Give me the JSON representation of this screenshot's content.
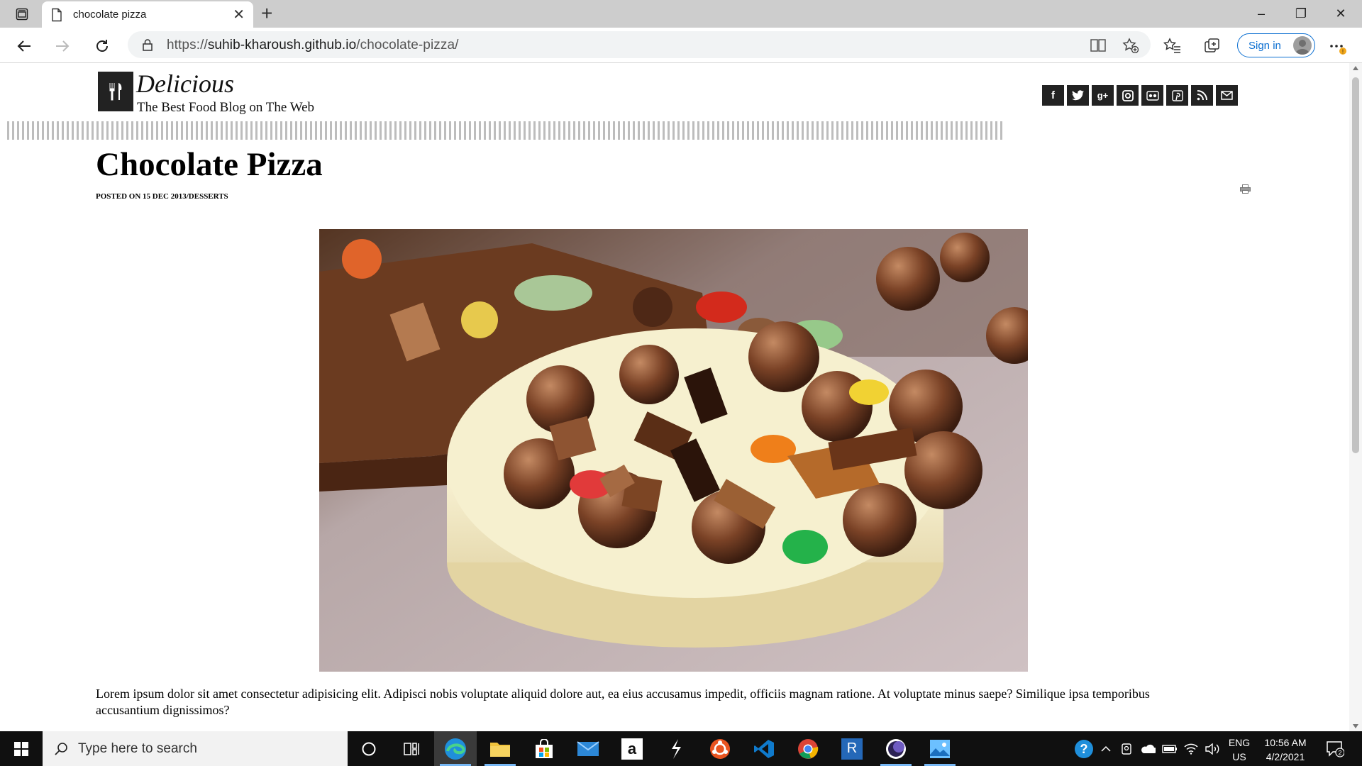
{
  "browser": {
    "tab": {
      "title": "chocolate pizza",
      "close": "✕"
    },
    "new_tab": "+",
    "url": {
      "scheme": "https://",
      "host": "suhib-kharoush.github.io",
      "path": "/chocolate-pizza/"
    },
    "sign_in": "Sign in",
    "window_controls": {
      "minimize": "–",
      "restore": "❐",
      "close": "✕"
    }
  },
  "site": {
    "name": "Delicious",
    "tagline": "The Best Food Blog on The Web",
    "social": [
      {
        "icon": "facebook-icon",
        "glyph": "f"
      },
      {
        "icon": "twitter-icon",
        "glyph": "t"
      },
      {
        "icon": "google-plus-icon",
        "glyph": "g+"
      },
      {
        "icon": "instagram-icon",
        "glyph": "◎"
      },
      {
        "icon": "flickr-icon",
        "glyph": "••"
      },
      {
        "icon": "pinterest-icon",
        "glyph": "P"
      },
      {
        "icon": "rss-icon",
        "glyph": "◝"
      },
      {
        "icon": "email-icon",
        "glyph": "✉"
      }
    ]
  },
  "post": {
    "title": "Chocolate Pizza",
    "meta": "POSTED ON 15 DEC 2013/DESSERTS",
    "body": "Lorem ipsum dolor sit amet consectetur adipisicing elit. Adipisci nobis voluptate aliquid dolore aut, ea eius accusamus impedit, officiis magnam ratione. At voluptate minus saepe? Similique ipsa temporibus accusantium dignissimos?"
  },
  "taskbar": {
    "search_placeholder": "Type here to search",
    "apps": [
      "cortana-icon",
      "task-view-icon",
      "edge-icon",
      "file-explorer-icon",
      "store-icon",
      "mail-icon",
      "amazon-icon",
      "app-icon",
      "ubuntu-icon",
      "vscode-icon",
      "chrome-icon",
      "r-icon",
      "eclipse-icon",
      "photos-icon"
    ],
    "amazon_glyph": "a",
    "r_glyph": "R",
    "lang_line1": "ENG",
    "lang_line2": "US",
    "time": "10:56 AM",
    "date": "4/2/2021",
    "notifications": "2"
  },
  "colors": {
    "accent": "#0a6ed1",
    "dark_tile": "#222222",
    "taskbar": "#101010"
  }
}
